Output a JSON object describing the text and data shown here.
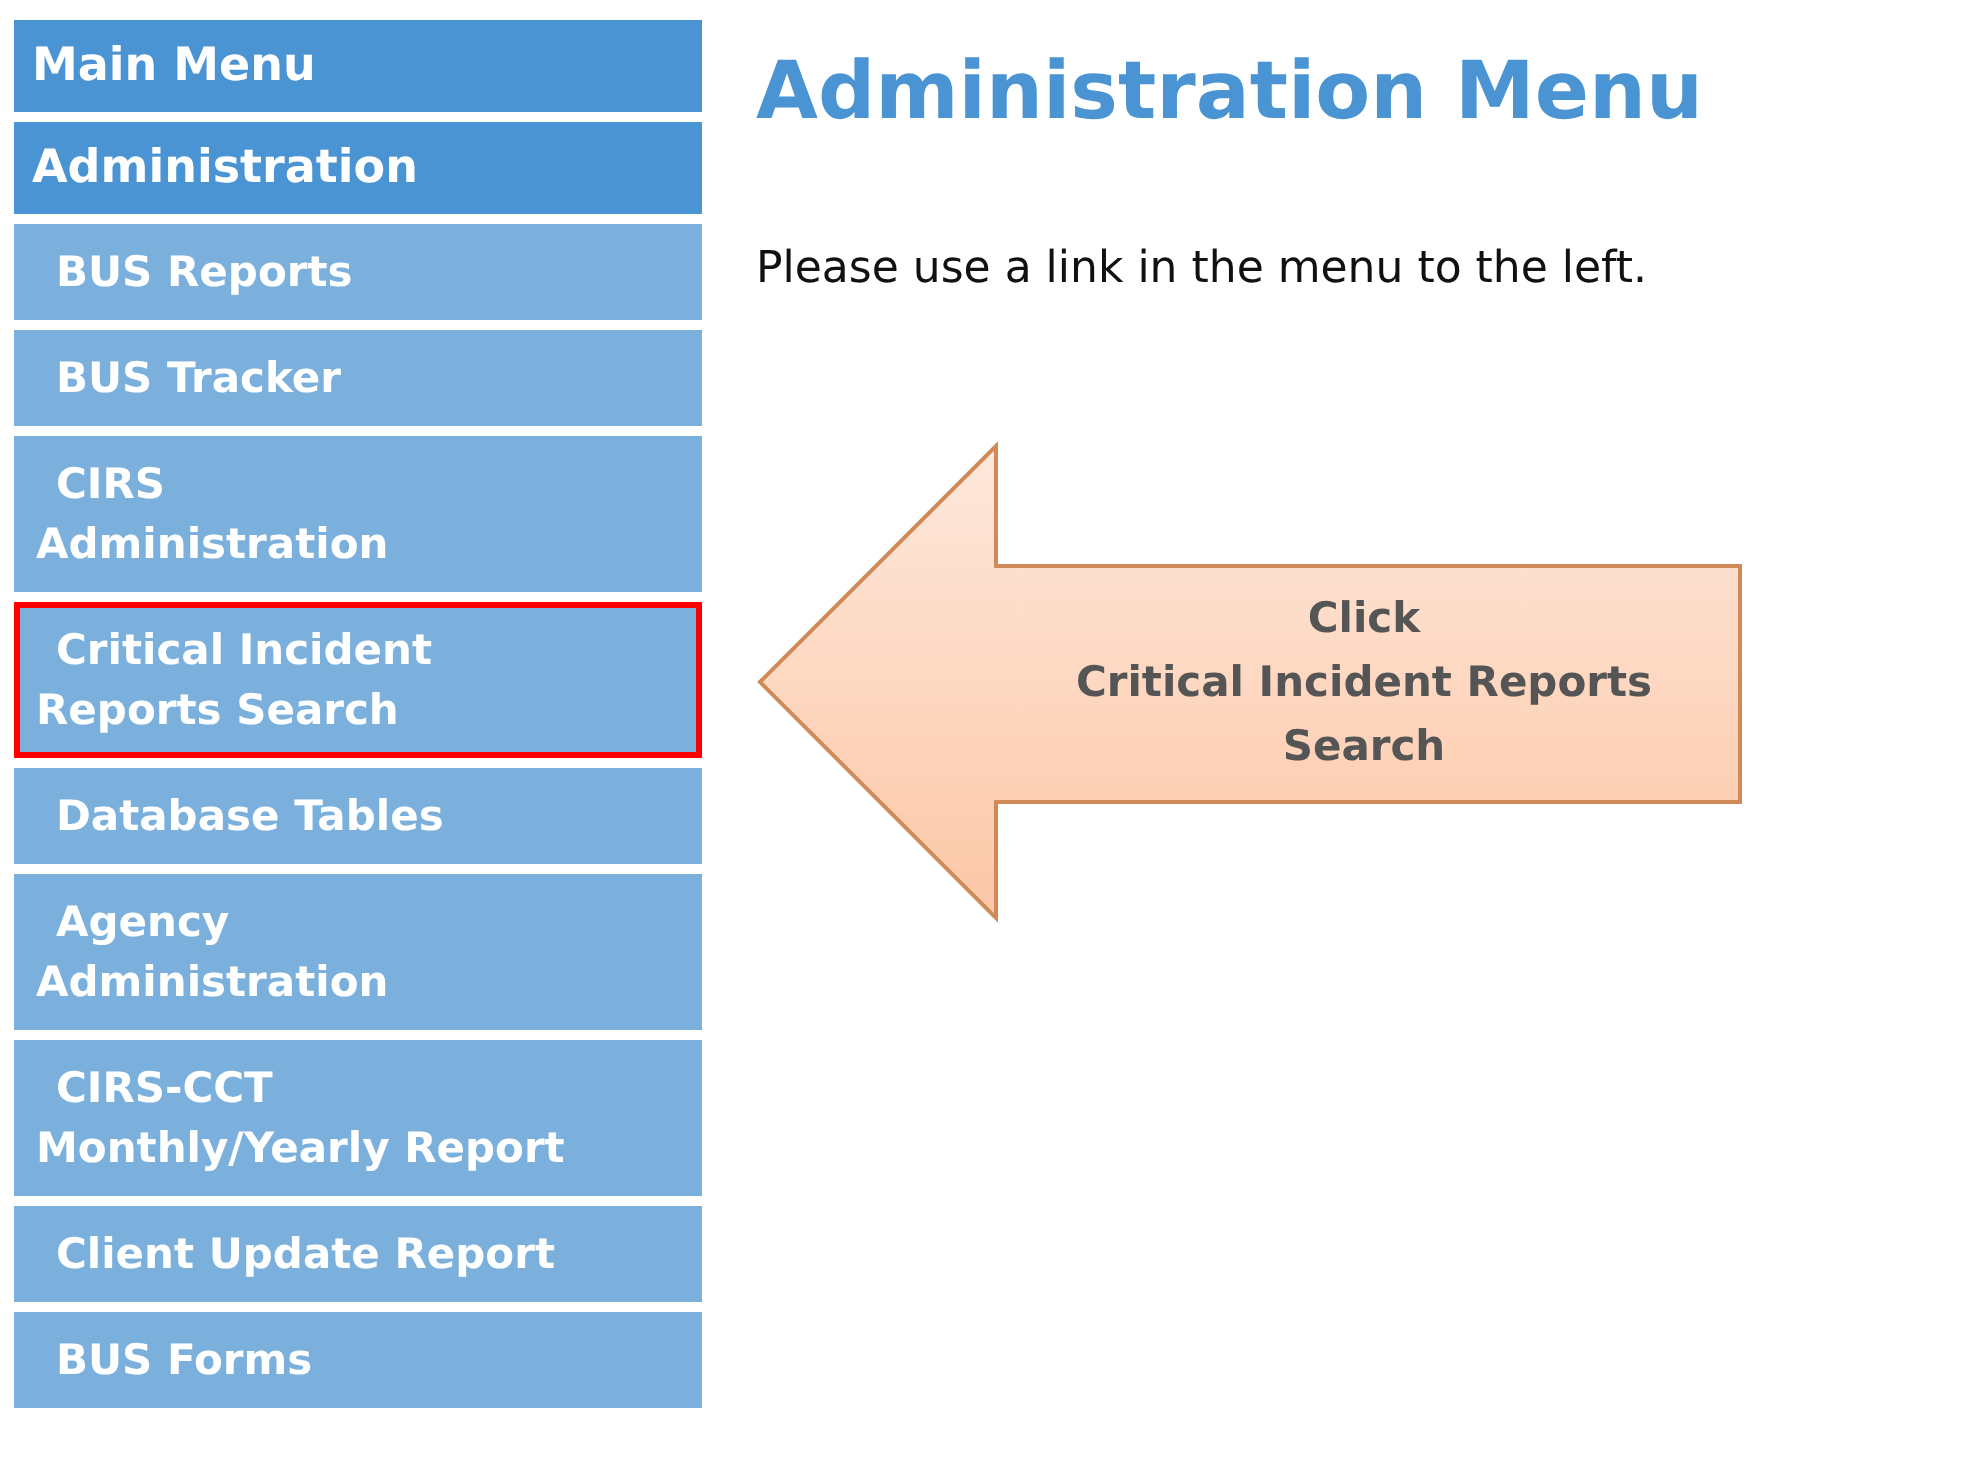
{
  "sidebar": {
    "items": [
      {
        "kind": "header",
        "label": "Main Menu",
        "highlighted": false
      },
      {
        "kind": "header",
        "label": "Administration",
        "highlighted": false
      },
      {
        "kind": "link",
        "label": "BUS Reports",
        "highlighted": false
      },
      {
        "kind": "link",
        "label": "BUS Tracker",
        "highlighted": false
      },
      {
        "kind": "link",
        "label": "CIRS\nAdministration",
        "highlighted": false
      },
      {
        "kind": "link",
        "label": "Critical Incident\nReports Search",
        "highlighted": true
      },
      {
        "kind": "link",
        "label": "Database Tables",
        "highlighted": false
      },
      {
        "kind": "link",
        "label": "Agency\nAdministration",
        "highlighted": false
      },
      {
        "kind": "link",
        "label": "CIRS-CCT\nMonthly/Yearly Report",
        "highlighted": false
      },
      {
        "kind": "link",
        "label": "Client Update Report",
        "highlighted": false
      },
      {
        "kind": "link",
        "label": "BUS Forms",
        "highlighted": false
      }
    ]
  },
  "main": {
    "title": "Administration Menu",
    "instruction": "Please use a link in the menu to the left.",
    "callout": {
      "text": "Click\nCritical Incident Reports\nSearch"
    }
  }
}
